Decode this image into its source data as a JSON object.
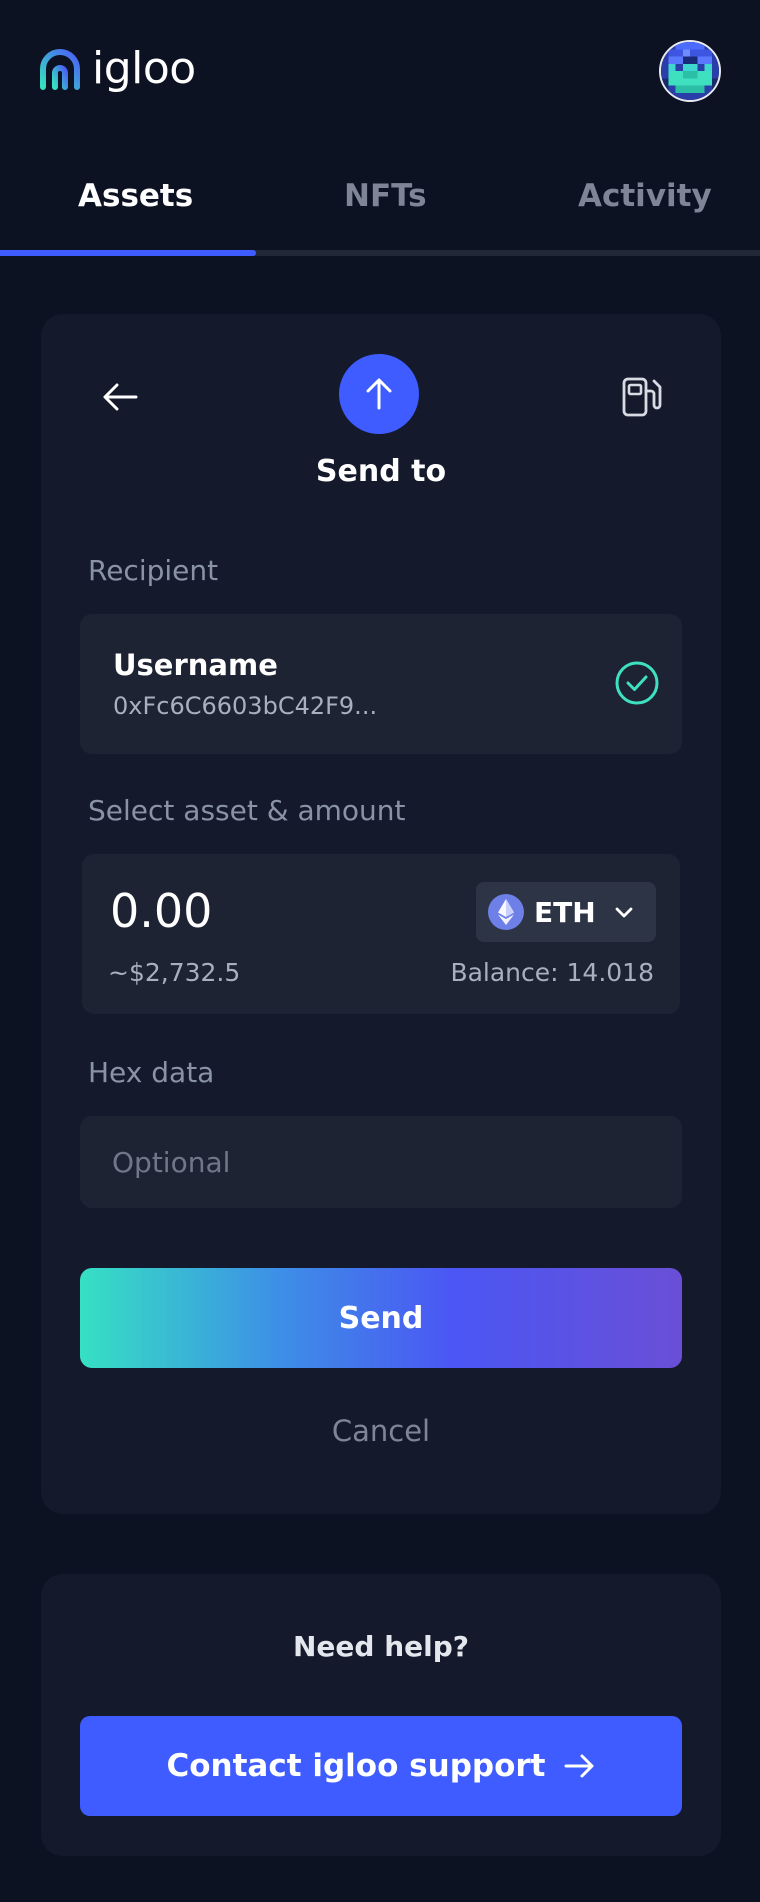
{
  "app": {
    "name": "igloo"
  },
  "tabs": [
    {
      "label": "Assets",
      "active": true
    },
    {
      "label": "NFTs",
      "active": false
    },
    {
      "label": "Activity",
      "active": false
    }
  ],
  "send": {
    "title": "Send to",
    "recipient_label": "Recipient",
    "recipient": {
      "name": "Username",
      "address": "0xFc6C6603bC42F9..."
    },
    "asset_label": "Select asset & amount",
    "amount": "0.00",
    "amount_usd": "~$2,732.5",
    "asset": {
      "code": "ETH",
      "icon": "ethereum-icon"
    },
    "balance": "Balance: 14.018",
    "hex_label": "Hex data",
    "hex_placeholder": "Optional",
    "send_label": "Send",
    "cancel_label": "Cancel"
  },
  "help": {
    "title": "Need help?",
    "contact_label": "Contact igloo support"
  },
  "colors": {
    "background": "#0c1222",
    "card": "#141a2b",
    "accent": "#3e5cff",
    "success": "#3ee0c0"
  }
}
